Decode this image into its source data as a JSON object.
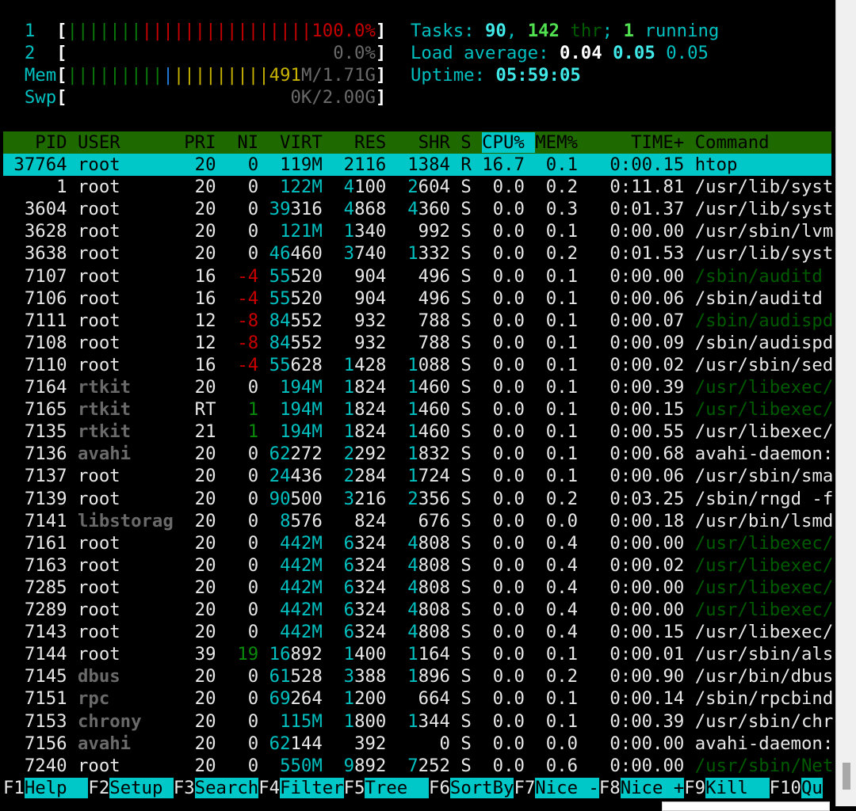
{
  "meters": {
    "cpu1": {
      "label": "1",
      "value": "100.0%",
      "bars_green": 7,
      "bars_red": 16,
      "percent": 100.0
    },
    "cpu2": {
      "label": "2",
      "value": "0.0%",
      "percent": 0.0
    },
    "mem": {
      "label": "Mem",
      "used": "491",
      "total": "M/1.71G",
      "bars_green": 9,
      "bars_blue": 1,
      "bars_yellow": 9
    },
    "swp": {
      "label": "Swp",
      "value": "0K/2.00G"
    }
  },
  "summary": {
    "tasks_label": "Tasks: ",
    "tasks": "90",
    "sep": ", ",
    "threads": "142",
    "thr_label": " thr",
    "semi": "; ",
    "running": "1",
    "running_label": " running",
    "load_label": "Load average: ",
    "load1": "0.04",
    "load5": "0.05",
    "load15": "0.05",
    "uptime_label": "Uptime: ",
    "uptime": "05:59:05"
  },
  "columns": [
    "PID",
    "USER",
    "PRI",
    "NI",
    "VIRT",
    "RES",
    "SHR",
    "S",
    "CPU%",
    "MEM%",
    "TIME+",
    "Command"
  ],
  "sort_column": "CPU%",
  "selected_pid": "37764",
  "processes": [
    {
      "pid": "37764",
      "user": "root",
      "pri": "20",
      "ni": "0",
      "virt": "119M",
      "res": "2116",
      "shr": "1384",
      "s": "R",
      "cpu": "16.7",
      "mem": "0.1",
      "time": "0:00.15",
      "cmd": "htop"
    },
    {
      "pid": "1",
      "user": "root",
      "pri": "20",
      "ni": "0",
      "virt": "122M",
      "res": "4100",
      "shr": "2604",
      "s": "S",
      "cpu": "0.0",
      "mem": "0.2",
      "time": "0:11.81",
      "cmd": "/usr/lib/syst"
    },
    {
      "pid": "3604",
      "user": "root",
      "pri": "20",
      "ni": "0",
      "virt": "39316",
      "res": "4868",
      "shr": "4360",
      "s": "S",
      "cpu": "0.0",
      "mem": "0.3",
      "time": "0:01.37",
      "cmd": "/usr/lib/syst"
    },
    {
      "pid": "3628",
      "user": "root",
      "pri": "20",
      "ni": "0",
      "virt": "121M",
      "res": "1340",
      "shr": "992",
      "s": "S",
      "cpu": "0.0",
      "mem": "0.1",
      "time": "0:00.00",
      "cmd": "/usr/sbin/lvm"
    },
    {
      "pid": "3638",
      "user": "root",
      "pri": "20",
      "ni": "0",
      "virt": "46460",
      "res": "3740",
      "shr": "1332",
      "s": "S",
      "cpu": "0.0",
      "mem": "0.2",
      "time": "0:01.53",
      "cmd": "/usr/lib/syst"
    },
    {
      "pid": "7107",
      "user": "root",
      "pri": "16",
      "ni": "-4",
      "virt": "55520",
      "res": "904",
      "shr": "496",
      "s": "S",
      "cpu": "0.0",
      "mem": "0.1",
      "time": "0:00.00",
      "cmd": "/sbin/auditd",
      "thread": true
    },
    {
      "pid": "7106",
      "user": "root",
      "pri": "16",
      "ni": "-4",
      "virt": "55520",
      "res": "904",
      "shr": "496",
      "s": "S",
      "cpu": "0.0",
      "mem": "0.1",
      "time": "0:00.06",
      "cmd": "/sbin/auditd"
    },
    {
      "pid": "7111",
      "user": "root",
      "pri": "12",
      "ni": "-8",
      "virt": "84552",
      "res": "932",
      "shr": "788",
      "s": "S",
      "cpu": "0.0",
      "mem": "0.1",
      "time": "0:00.07",
      "cmd": "/sbin/audispd",
      "thread": true
    },
    {
      "pid": "7108",
      "user": "root",
      "pri": "12",
      "ni": "-8",
      "virt": "84552",
      "res": "932",
      "shr": "788",
      "s": "S",
      "cpu": "0.0",
      "mem": "0.1",
      "time": "0:00.09",
      "cmd": "/sbin/audispd"
    },
    {
      "pid": "7110",
      "user": "root",
      "pri": "16",
      "ni": "-4",
      "virt": "55628",
      "res": "1428",
      "shr": "1088",
      "s": "S",
      "cpu": "0.0",
      "mem": "0.1",
      "time": "0:00.02",
      "cmd": "/usr/sbin/sed"
    },
    {
      "pid": "7164",
      "user": "rtkit",
      "pri": "20",
      "ni": "0",
      "virt": "194M",
      "res": "1824",
      "shr": "1460",
      "s": "S",
      "cpu": "0.0",
      "mem": "0.1",
      "time": "0:00.39",
      "cmd": "/usr/libexec/",
      "thread": true
    },
    {
      "pid": "7165",
      "user": "rtkit",
      "pri": "RT",
      "ni": "1",
      "virt": "194M",
      "res": "1824",
      "shr": "1460",
      "s": "S",
      "cpu": "0.0",
      "mem": "0.1",
      "time": "0:00.15",
      "cmd": "/usr/libexec/",
      "thread": true
    },
    {
      "pid": "7135",
      "user": "rtkit",
      "pri": "21",
      "ni": "1",
      "virt": "194M",
      "res": "1824",
      "shr": "1460",
      "s": "S",
      "cpu": "0.0",
      "mem": "0.1",
      "time": "0:00.55",
      "cmd": "/usr/libexec/"
    },
    {
      "pid": "7136",
      "user": "avahi",
      "pri": "20",
      "ni": "0",
      "virt": "62272",
      "res": "2292",
      "shr": "1832",
      "s": "S",
      "cpu": "0.0",
      "mem": "0.1",
      "time": "0:00.68",
      "cmd": "avahi-daemon:"
    },
    {
      "pid": "7137",
      "user": "root",
      "pri": "20",
      "ni": "0",
      "virt": "24436",
      "res": "2284",
      "shr": "1724",
      "s": "S",
      "cpu": "0.0",
      "mem": "0.1",
      "time": "0:00.06",
      "cmd": "/usr/sbin/sma"
    },
    {
      "pid": "7139",
      "user": "root",
      "pri": "20",
      "ni": "0",
      "virt": "90500",
      "res": "3216",
      "shr": "2356",
      "s": "S",
      "cpu": "0.0",
      "mem": "0.2",
      "time": "0:03.25",
      "cmd": "/sbin/rngd -f"
    },
    {
      "pid": "7141",
      "user": "libstorag",
      "pri": "20",
      "ni": "0",
      "virt": "8576",
      "res": "824",
      "shr": "676",
      "s": "S",
      "cpu": "0.0",
      "mem": "0.0",
      "time": "0:00.18",
      "cmd": "/usr/bin/lsmd"
    },
    {
      "pid": "7161",
      "user": "root",
      "pri": "20",
      "ni": "0",
      "virt": "442M",
      "res": "6324",
      "shr": "4808",
      "s": "S",
      "cpu": "0.0",
      "mem": "0.4",
      "time": "0:00.00",
      "cmd": "/usr/libexec/",
      "thread": true
    },
    {
      "pid": "7163",
      "user": "root",
      "pri": "20",
      "ni": "0",
      "virt": "442M",
      "res": "6324",
      "shr": "4808",
      "s": "S",
      "cpu": "0.0",
      "mem": "0.4",
      "time": "0:00.02",
      "cmd": "/usr/libexec/",
      "thread": true
    },
    {
      "pid": "7285",
      "user": "root",
      "pri": "20",
      "ni": "0",
      "virt": "442M",
      "res": "6324",
      "shr": "4808",
      "s": "S",
      "cpu": "0.0",
      "mem": "0.4",
      "time": "0:00.00",
      "cmd": "/usr/libexec/",
      "thread": true
    },
    {
      "pid": "7289",
      "user": "root",
      "pri": "20",
      "ni": "0",
      "virt": "442M",
      "res": "6324",
      "shr": "4808",
      "s": "S",
      "cpu": "0.0",
      "mem": "0.4",
      "time": "0:00.00",
      "cmd": "/usr/libexec/",
      "thread": true
    },
    {
      "pid": "7143",
      "user": "root",
      "pri": "20",
      "ni": "0",
      "virt": "442M",
      "res": "6324",
      "shr": "4808",
      "s": "S",
      "cpu": "0.0",
      "mem": "0.4",
      "time": "0:00.15",
      "cmd": "/usr/libexec/"
    },
    {
      "pid": "7144",
      "user": "root",
      "pri": "39",
      "ni": "19",
      "virt": "16892",
      "res": "1400",
      "shr": "1164",
      "s": "S",
      "cpu": "0.0",
      "mem": "0.1",
      "time": "0:00.01",
      "cmd": "/usr/sbin/als"
    },
    {
      "pid": "7145",
      "user": "dbus",
      "pri": "20",
      "ni": "0",
      "virt": "61528",
      "res": "3388",
      "shr": "1896",
      "s": "S",
      "cpu": "0.0",
      "mem": "0.2",
      "time": "0:00.90",
      "cmd": "/usr/bin/dbus"
    },
    {
      "pid": "7151",
      "user": "rpc",
      "pri": "20",
      "ni": "0",
      "virt": "69264",
      "res": "1200",
      "shr": "664",
      "s": "S",
      "cpu": "0.0",
      "mem": "0.1",
      "time": "0:00.14",
      "cmd": "/sbin/rpcbind"
    },
    {
      "pid": "7153",
      "user": "chrony",
      "pri": "20",
      "ni": "0",
      "virt": "115M",
      "res": "1800",
      "shr": "1344",
      "s": "S",
      "cpu": "0.0",
      "mem": "0.1",
      "time": "0:00.39",
      "cmd": "/usr/sbin/chr"
    },
    {
      "pid": "7156",
      "user": "avahi",
      "pri": "20",
      "ni": "0",
      "virt": "62144",
      "res": "392",
      "shr": "0",
      "s": "S",
      "cpu": "0.0",
      "mem": "0.0",
      "time": "0:00.00",
      "cmd": "avahi-daemon:"
    },
    {
      "pid": "7240",
      "user": "root",
      "pri": "20",
      "ni": "0",
      "virt": "550M",
      "res": "9892",
      "shr": "7252",
      "s": "S",
      "cpu": "0.0",
      "mem": "0.6",
      "time": "0:00.00",
      "cmd": "/usr/sbin/Net",
      "thread": true
    }
  ],
  "function_keys": [
    {
      "key": "F1",
      "label": "Help"
    },
    {
      "key": "F2",
      "label": "Setup"
    },
    {
      "key": "F3",
      "label": "Search"
    },
    {
      "key": "F4",
      "label": "Filter"
    },
    {
      "key": "F5",
      "label": "Tree"
    },
    {
      "key": "F6",
      "label": "SortBy"
    },
    {
      "key": "F7",
      "label": "Nice -"
    },
    {
      "key": "F8",
      "label": "Nice +"
    },
    {
      "key": "F9",
      "label": "Kill"
    },
    {
      "key": "F10",
      "label": "Qu"
    }
  ]
}
